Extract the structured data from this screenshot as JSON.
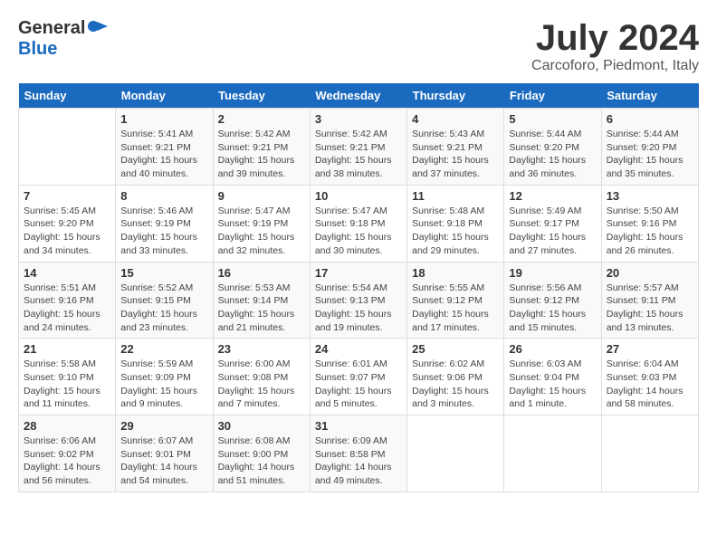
{
  "header": {
    "logo_general": "General",
    "logo_blue": "Blue",
    "month_title": "July 2024",
    "subtitle": "Carcoforo, Piedmont, Italy"
  },
  "days_of_week": [
    "Sunday",
    "Monday",
    "Tuesday",
    "Wednesday",
    "Thursday",
    "Friday",
    "Saturday"
  ],
  "weeks": [
    [
      {
        "day": "",
        "info": ""
      },
      {
        "day": "1",
        "info": "Sunrise: 5:41 AM\nSunset: 9:21 PM\nDaylight: 15 hours\nand 40 minutes."
      },
      {
        "day": "2",
        "info": "Sunrise: 5:42 AM\nSunset: 9:21 PM\nDaylight: 15 hours\nand 39 minutes."
      },
      {
        "day": "3",
        "info": "Sunrise: 5:42 AM\nSunset: 9:21 PM\nDaylight: 15 hours\nand 38 minutes."
      },
      {
        "day": "4",
        "info": "Sunrise: 5:43 AM\nSunset: 9:21 PM\nDaylight: 15 hours\nand 37 minutes."
      },
      {
        "day": "5",
        "info": "Sunrise: 5:44 AM\nSunset: 9:20 PM\nDaylight: 15 hours\nand 36 minutes."
      },
      {
        "day": "6",
        "info": "Sunrise: 5:44 AM\nSunset: 9:20 PM\nDaylight: 15 hours\nand 35 minutes."
      }
    ],
    [
      {
        "day": "7",
        "info": "Sunrise: 5:45 AM\nSunset: 9:20 PM\nDaylight: 15 hours\nand 34 minutes."
      },
      {
        "day": "8",
        "info": "Sunrise: 5:46 AM\nSunset: 9:19 PM\nDaylight: 15 hours\nand 33 minutes."
      },
      {
        "day": "9",
        "info": "Sunrise: 5:47 AM\nSunset: 9:19 PM\nDaylight: 15 hours\nand 32 minutes."
      },
      {
        "day": "10",
        "info": "Sunrise: 5:47 AM\nSunset: 9:18 PM\nDaylight: 15 hours\nand 30 minutes."
      },
      {
        "day": "11",
        "info": "Sunrise: 5:48 AM\nSunset: 9:18 PM\nDaylight: 15 hours\nand 29 minutes."
      },
      {
        "day": "12",
        "info": "Sunrise: 5:49 AM\nSunset: 9:17 PM\nDaylight: 15 hours\nand 27 minutes."
      },
      {
        "day": "13",
        "info": "Sunrise: 5:50 AM\nSunset: 9:16 PM\nDaylight: 15 hours\nand 26 minutes."
      }
    ],
    [
      {
        "day": "14",
        "info": "Sunrise: 5:51 AM\nSunset: 9:16 PM\nDaylight: 15 hours\nand 24 minutes."
      },
      {
        "day": "15",
        "info": "Sunrise: 5:52 AM\nSunset: 9:15 PM\nDaylight: 15 hours\nand 23 minutes."
      },
      {
        "day": "16",
        "info": "Sunrise: 5:53 AM\nSunset: 9:14 PM\nDaylight: 15 hours\nand 21 minutes."
      },
      {
        "day": "17",
        "info": "Sunrise: 5:54 AM\nSunset: 9:13 PM\nDaylight: 15 hours\nand 19 minutes."
      },
      {
        "day": "18",
        "info": "Sunrise: 5:55 AM\nSunset: 9:12 PM\nDaylight: 15 hours\nand 17 minutes."
      },
      {
        "day": "19",
        "info": "Sunrise: 5:56 AM\nSunset: 9:12 PM\nDaylight: 15 hours\nand 15 minutes."
      },
      {
        "day": "20",
        "info": "Sunrise: 5:57 AM\nSunset: 9:11 PM\nDaylight: 15 hours\nand 13 minutes."
      }
    ],
    [
      {
        "day": "21",
        "info": "Sunrise: 5:58 AM\nSunset: 9:10 PM\nDaylight: 15 hours\nand 11 minutes."
      },
      {
        "day": "22",
        "info": "Sunrise: 5:59 AM\nSunset: 9:09 PM\nDaylight: 15 hours\nand 9 minutes."
      },
      {
        "day": "23",
        "info": "Sunrise: 6:00 AM\nSunset: 9:08 PM\nDaylight: 15 hours\nand 7 minutes."
      },
      {
        "day": "24",
        "info": "Sunrise: 6:01 AM\nSunset: 9:07 PM\nDaylight: 15 hours\nand 5 minutes."
      },
      {
        "day": "25",
        "info": "Sunrise: 6:02 AM\nSunset: 9:06 PM\nDaylight: 15 hours\nand 3 minutes."
      },
      {
        "day": "26",
        "info": "Sunrise: 6:03 AM\nSunset: 9:04 PM\nDaylight: 15 hours\nand 1 minute."
      },
      {
        "day": "27",
        "info": "Sunrise: 6:04 AM\nSunset: 9:03 PM\nDaylight: 14 hours\nand 58 minutes."
      }
    ],
    [
      {
        "day": "28",
        "info": "Sunrise: 6:06 AM\nSunset: 9:02 PM\nDaylight: 14 hours\nand 56 minutes."
      },
      {
        "day": "29",
        "info": "Sunrise: 6:07 AM\nSunset: 9:01 PM\nDaylight: 14 hours\nand 54 minutes."
      },
      {
        "day": "30",
        "info": "Sunrise: 6:08 AM\nSunset: 9:00 PM\nDaylight: 14 hours\nand 51 minutes."
      },
      {
        "day": "31",
        "info": "Sunrise: 6:09 AM\nSunset: 8:58 PM\nDaylight: 14 hours\nand 49 minutes."
      },
      {
        "day": "",
        "info": ""
      },
      {
        "day": "",
        "info": ""
      },
      {
        "day": "",
        "info": ""
      }
    ]
  ]
}
